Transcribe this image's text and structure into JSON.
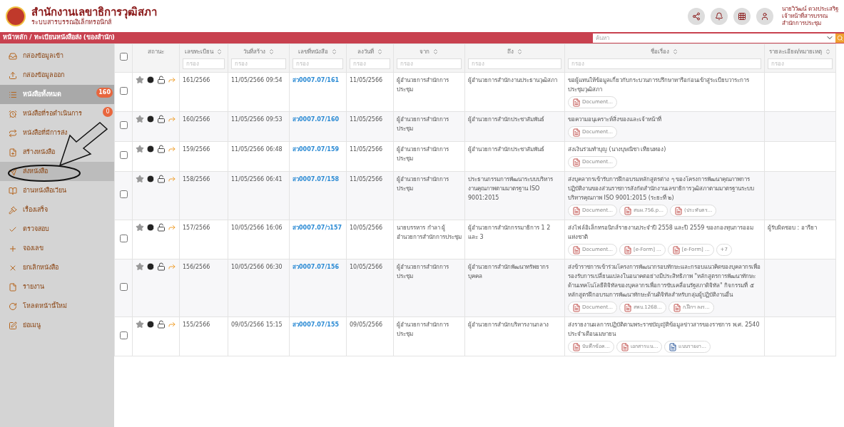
{
  "header": {
    "title": "สำนักงานเลขาธิการวุฒิสภา",
    "subtitle": "ระบบสารบรรณอิเล็กทรอนิกส์",
    "user": {
      "name": "นายวิวัฒน์ ดวงประเสริฐ",
      "role": "เจ้าหน้าที่สารบรรณ",
      "office": "สำนักการประชุม"
    }
  },
  "breadcrumb": "หน้าหลัก / ทะเบียนหนังสือส่ง (ของสำนัก)",
  "search": {
    "placeholder": "ค้นหา"
  },
  "sidebar": {
    "items": [
      {
        "label": "กล่องข้อมูลเข้า",
        "selected": false,
        "hovered": false
      },
      {
        "label": "กล่องข้อมูลออก",
        "selected": false,
        "hovered": false
      },
      {
        "label": "หนังสือทั้งหมด",
        "selected": true,
        "hovered": false,
        "badge": "160"
      },
      {
        "label": "หนังสือที่รอดำเนินการ",
        "selected": false,
        "hovered": false,
        "badge": "0"
      },
      {
        "label": "หนังสือที่มีการส่ง",
        "selected": false,
        "hovered": false
      },
      {
        "label": "สร้างหนังสือ",
        "selected": false,
        "hovered": false
      },
      {
        "label": "ส่งหนังสือ",
        "selected": false,
        "hovered": true
      },
      {
        "label": "อ่านหนังสือเวียน",
        "selected": false,
        "hovered": false
      },
      {
        "label": "เรื่องเสร็จ",
        "selected": false,
        "hovered": false
      },
      {
        "label": "ตรวจสอบ",
        "selected": false,
        "hovered": false
      },
      {
        "label": "จองเลข",
        "selected": false,
        "hovered": false
      },
      {
        "label": "ยกเลิกหนังสือ",
        "selected": false,
        "hovered": false
      },
      {
        "label": "รายงาน",
        "selected": false,
        "hovered": false
      },
      {
        "label": "โหลดหน้านี้ใหม่",
        "selected": false,
        "hovered": false
      },
      {
        "label": "ย่อเมนู",
        "selected": false,
        "hovered": false
      }
    ]
  },
  "table": {
    "select_all_checked": false,
    "columns": [
      {
        "label": "สถานะ",
        "sortable": false
      },
      {
        "label": "เลขทะเบียน",
        "sortable": true,
        "placeholder": "กรอง"
      },
      {
        "label": "วันที่สร้าง",
        "sortable": true,
        "placeholder": "กรอง"
      },
      {
        "label": "เลขที่หนังสือ",
        "sortable": true,
        "placeholder": "กรอง"
      },
      {
        "label": "ลงวันที่",
        "sortable": true,
        "placeholder": "กรอง"
      },
      {
        "label": "จาก",
        "sortable": true,
        "placeholder": "กรอง"
      },
      {
        "label": "ถึง",
        "sortable": true,
        "placeholder": "กรอง"
      },
      {
        "label": "ชื่อเรื่อง",
        "sortable": true,
        "placeholder": "กรอง"
      },
      {
        "label": "รายละเอียด/หมายเหตุ",
        "sortable": true,
        "placeholder": "กรอง"
      }
    ],
    "rows": [
      {
        "checked": false,
        "reg_no": "161/2566",
        "created": "11/05/2566 09:54",
        "doc_no": "สว0007.07/161",
        "dated": "11/05/2566",
        "from": "ผู้อำนวยการสำนักการประชุม",
        "to": "ผู้อำนวยการสำนักงานประธานวุฒิสภา",
        "subject": "ขอผู้แทนให้ข้อมูลเกี่ยวกับกระบวนการปรึกษาหารือก่อนเข้าสู่ระเบียบวาระการประชุมวุฒิสภา",
        "attachments": [
          {
            "kind": "pdf",
            "name": "Document..."
          }
        ]
      },
      {
        "checked": false,
        "reg_no": "160/2566",
        "created": "11/05/2566 09:53",
        "doc_no": "สว0007.07/160",
        "dated": "11/05/2566",
        "from": "ผู้อำนวยการสำนักการประชุม",
        "to": "ผู้อำนวยการสำนักประชาสัมพันธ์",
        "subject": "ขอความอนุเคราะห์สิ่งของและเจ้าหน้าที่",
        "attachments": [
          {
            "kind": "pdf",
            "name": "Document..."
          }
        ]
      },
      {
        "checked": false,
        "reg_no": "159/2566",
        "created": "11/05/2566 06:48",
        "doc_no": "สว0007.07/159",
        "dated": "11/05/2566",
        "from": "ผู้อำนวยการสำนักการประชุม",
        "to": "ผู้อำนวยการสำนักประชาสัมพันธ์",
        "subject": "ส่งเงินร่วมทำบุญ (นางบุษณิชา เทียนทอง)",
        "attachments": [
          {
            "kind": "pdf",
            "name": "Document..."
          }
        ]
      },
      {
        "checked": false,
        "reg_no": "158/2566",
        "created": "11/05/2566 06:41",
        "doc_no": "สว0007.07/158",
        "dated": "11/05/2566",
        "from": "ผู้อำนวยการสำนักการประชุม",
        "to": "ประธานกรรมการพัฒนาระบบบริหารงานคุณภาพตามมาตรฐาน ISO 9001:2015",
        "subject": "ส่งบุคลากรเข้ารับการฝึกอบรมหลักสูตรต่าง ๆ ของโครงการพัฒนาคุณภาพการปฏิบัติงานของส่วนราชการสังกัดสำนักงานเลขาธิการวุฒิสภาตามมาตรฐานระบบบริหารคุณภาพ ISO 9001:2015 (ระยะที่ ๒)",
        "attachments": [
          {
            "kind": "pdf",
            "name": "Document..."
          },
          {
            "kind": "pdf",
            "name": "สนผ.756.p..."
          },
          {
            "kind": "pdf",
            "name": "(ประทับตร..."
          }
        ]
      },
      {
        "checked": false,
        "reg_no": "157/2566",
        "created": "10/05/2566 16:06",
        "doc_no": "สว0007.07/ว157",
        "dated": "10/05/2566",
        "from": "นายบรรหาร กำลา ผู้อำนวยการสำนักการประชุม",
        "to": "ผู้อำนวยการสำนักกรรมาธิการ 1 2 และ 3",
        "subject": "ส่งไฟล์อิเล็กทรอนิกส์รายงานประจำปี 2558 และปี 2559 ของกองทุนการออมแห่งชาติ",
        "detail": "ผู้รับผิดชอบ : อารียา",
        "attachments": [
          {
            "kind": "pdf",
            "name": "Document..."
          },
          {
            "kind": "pdf",
            "name": "[e-Form] ..."
          },
          {
            "kind": "pdf",
            "name": "[e-Form] ..."
          },
          {
            "kind": "more",
            "name": "+7"
          }
        ]
      },
      {
        "checked": false,
        "reg_no": "156/2566",
        "created": "10/05/2566 06:30",
        "doc_no": "สว0007.07/156",
        "dated": "10/05/2566",
        "from": "ผู้อำนวยการสำนักการประชุม",
        "to": "ผู้อำนวยการสำนักพัฒนาทรัพยากรบุคคล",
        "subject": "ส่งข้าราชการเข้าร่วมโครงการพัฒนากรอบทักษะและกรอบแนวคิดของบุคลากรเพื่อรองรับการเปลี่ยนแปลงในอนาคตอย่างมีประสิทธิภาพ \"หลักสูตรการพัฒนาทักษะด้านเทคโนโลยีดิจิทัลของบุคลากรเพื่อการขับเคลื่อนรัฐสภาดิจิทัล\" กิจกรรมที่ ๕ หลักสูตรฝึกอบรมการพัฒนาทักษะด้านดิจิทัลสำหรับกลุ่มผู้ปฏิบัติงานอื่น",
        "attachments": [
          {
            "kind": "pdf",
            "name": "Document..."
          },
          {
            "kind": "pdf",
            "name": "สพบ.1268..."
          },
          {
            "kind": "pdf",
            "name": "ก.ฝึกฯ ลงร..."
          }
        ]
      },
      {
        "checked": false,
        "reg_no": "155/2566",
        "created": "09/05/2566 15:15",
        "doc_no": "สว0007.07/155",
        "dated": "09/05/2566",
        "from": "ผู้อำนวยการสำนักการประชุม",
        "to": "ผู้อำนวยการสำนักบริหารงานกลาง",
        "subject": "ส่งรายงานผลการปฏิบัติตามพระราชบัญญัติข้อมูลข่าวสารของราชการ พ.ศ. 2540 ประจำเดือนเมษายน",
        "attachments": [
          {
            "kind": "pdf",
            "name": "บันทึกข้อค..."
          },
          {
            "kind": "pdf",
            "name": "เอกสารแน..."
          },
          {
            "kind": "word",
            "name": "แบบรายงา..."
          }
        ]
      }
    ]
  }
}
